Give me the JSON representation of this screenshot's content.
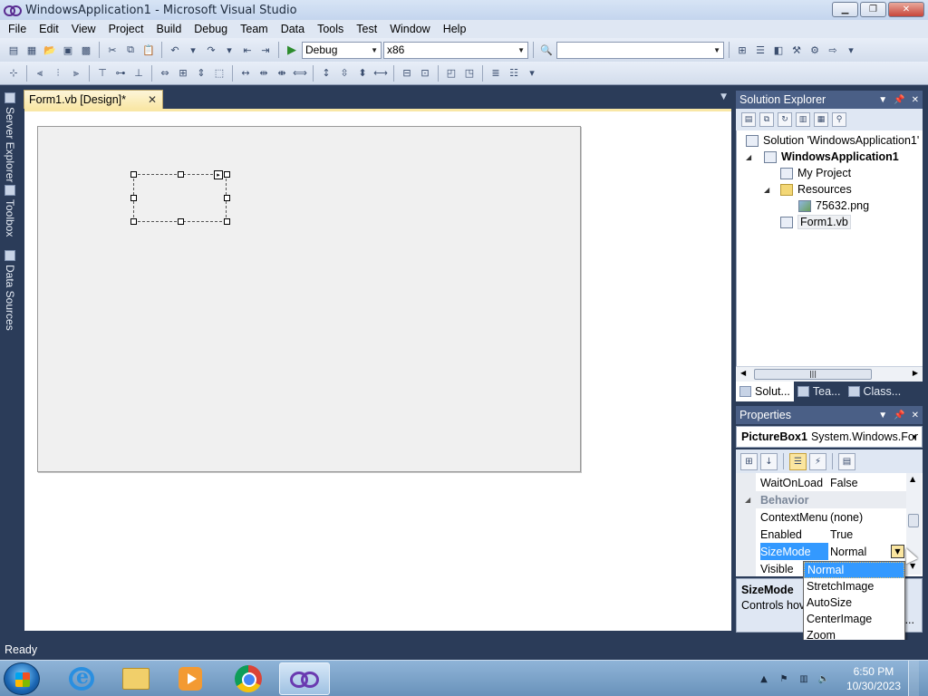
{
  "window": {
    "title": "WindowsApplication1 - Microsoft Visual Studio"
  },
  "menu": [
    "File",
    "Edit",
    "View",
    "Project",
    "Build",
    "Debug",
    "Team",
    "Data",
    "Tools",
    "Test",
    "Window",
    "Help"
  ],
  "toolbar": {
    "config": "Debug",
    "platform": "x86",
    "find_value": ""
  },
  "left_dock": [
    "Server Explorer",
    "Toolbox",
    "Data Sources"
  ],
  "editor": {
    "tab_label": "Form1.vb [Design]*"
  },
  "solution_explorer": {
    "title": "Solution Explorer",
    "solution": "Solution 'WindowsApplication1'",
    "project": "WindowsApplication1",
    "my_project": "My Project",
    "resources": "Resources",
    "resource_file": "75632.png",
    "form": "Form1.vb",
    "tabs": [
      "Solut...",
      "Tea...",
      "Class..."
    ]
  },
  "properties": {
    "title": "Properties",
    "object_name": "PictureBox1",
    "object_type": "System.Windows.For",
    "rows": [
      {
        "name": "WaitOnLoad",
        "value": "False"
      },
      {
        "name": "Behavior",
        "value": ""
      },
      {
        "name": "ContextMenu",
        "value": "(none)"
      },
      {
        "name": "Enabled",
        "value": "True"
      },
      {
        "name": "SizeMode",
        "value": "Normal"
      },
      {
        "name": "Visible",
        "value": ""
      }
    ],
    "desc_title": "SizeMode",
    "desc_text": "Controls hov handle imag",
    "desc_more": "..."
  },
  "dropdown": {
    "options": [
      "Normal",
      "StretchImage",
      "AutoSize",
      "CenterImage",
      "Zoom"
    ],
    "selected": "Normal"
  },
  "status": {
    "text": "Ready"
  },
  "taskbar": {
    "time": "6:50 PM",
    "date": "10/30/2023"
  },
  "colors": {
    "accent": "#3399ff",
    "panel_title": "#4a5f86",
    "ide_background": "#2b3c59",
    "tab_active": "#f9e7a6"
  }
}
